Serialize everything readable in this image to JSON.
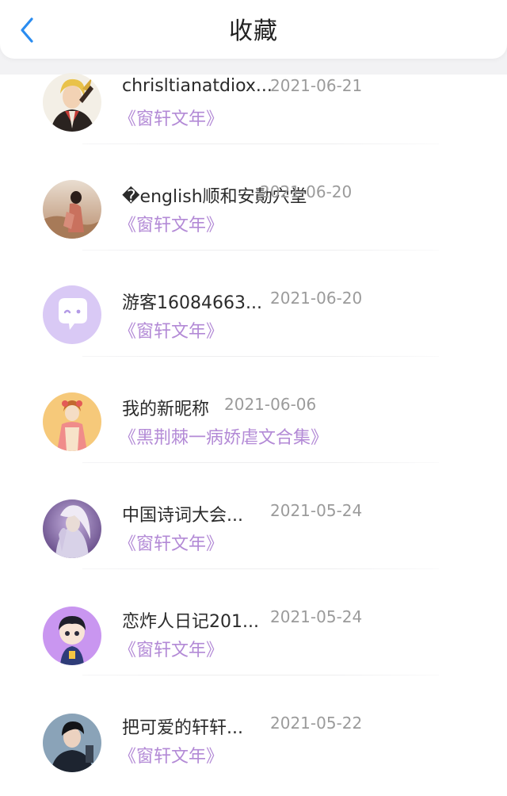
{
  "header": {
    "title": "收藏",
    "back_icon": "chevron-left-icon",
    "back_color": "#2a8cf0"
  },
  "colors": {
    "accent_purple": "#b38ad6",
    "date_gray": "#9b9b9b",
    "name_text": "#2b2b2b"
  },
  "items": [
    {
      "name": "chrisltianatdiox...",
      "date": "2021-06-21",
      "collection": "《窗轩文年》",
      "avatar": "avatar-blonde-character"
    },
    {
      "name": "�english顺和安勣穴堂",
      "date": "2021-06-20",
      "collection": "《窗轩文年》",
      "avatar": "avatar-woman-desert"
    },
    {
      "name": "游客16084663...",
      "date": "2021-06-20",
      "collection": "《窗轩文年》",
      "avatar": "avatar-default-chat"
    },
    {
      "name": "我的新昵称",
      "date": "2021-06-06",
      "collection": "《黑荆棘一病娇虐文合集》",
      "avatar": "avatar-kimono-girl"
    },
    {
      "name": "中国诗词大会...",
      "date": "2021-05-24",
      "collection": "《窗轩文年》",
      "avatar": "avatar-silver-hair"
    },
    {
      "name": "恋炸人日记201...",
      "date": "2021-05-24",
      "collection": "《窗轩文年》",
      "avatar": "avatar-chibi-boy"
    },
    {
      "name": "把可爱的轩轩...",
      "date": "2021-05-22",
      "collection": "《窗轩文年》",
      "avatar": "avatar-young-man"
    }
  ]
}
